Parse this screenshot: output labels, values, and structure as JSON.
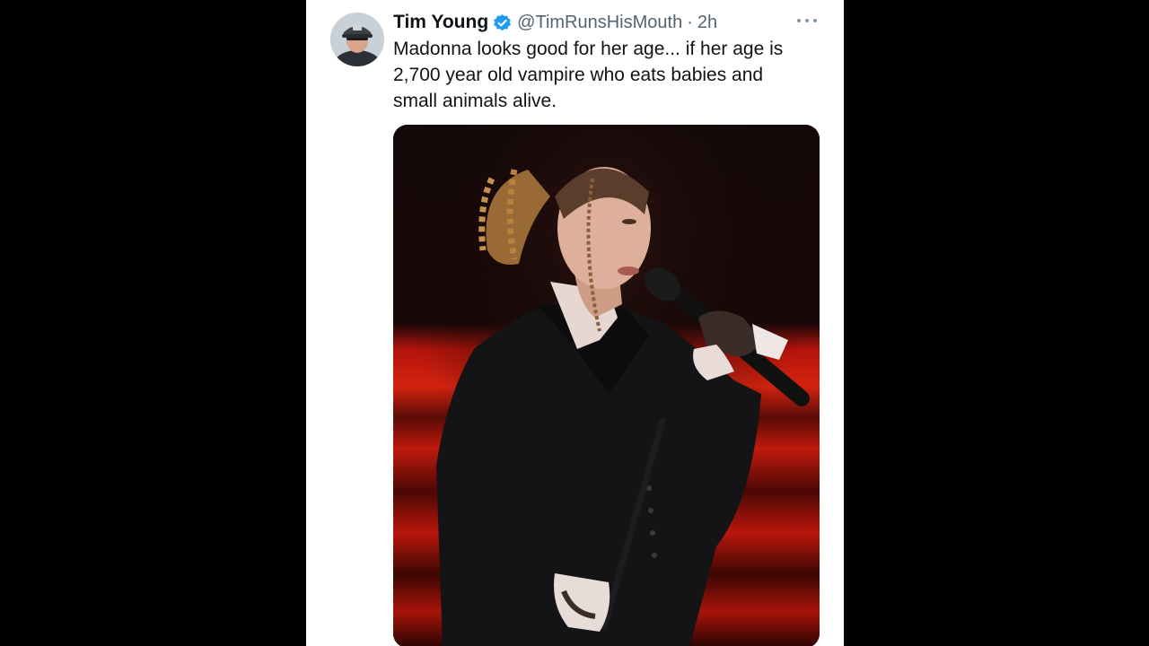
{
  "tweet": {
    "display_name": "Tim Young",
    "verified": true,
    "handle": "@TimRunsHisMouth",
    "separator": "·",
    "timestamp": "2h",
    "text_lines": [
      "Madonna looks good for her age... if her age is",
      "2,700 year old vampire who eats babies and",
      "small animals alive."
    ],
    "avatar_icon": "user-avatar-photo",
    "more_icon": "more-horizontal-icon",
    "verified_icon": "verified-badge-icon",
    "media_icon": "tweet-photo"
  },
  "colors": {
    "card_background": "#ffffff",
    "page_background": "#000000",
    "primary_text": "#0f1419",
    "secondary_text": "#536471",
    "verified_blue": "#1d9bf0",
    "stage_red": "#c41b10"
  }
}
